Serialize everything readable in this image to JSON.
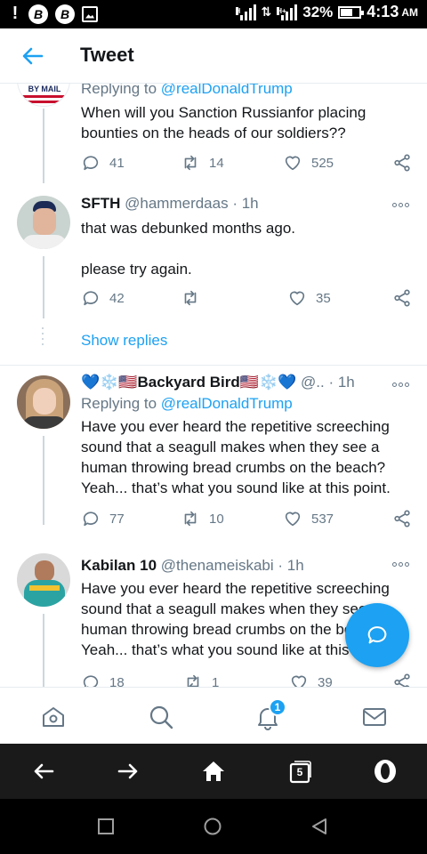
{
  "status_bar": {
    "battery": "32%",
    "time": "4:13",
    "ampm": "AM",
    "b_badge_1": "B",
    "b_badge_2": "B",
    "sig1_label": "H",
    "sig2_label": "H+"
  },
  "header": {
    "title": "Tweet"
  },
  "tweets": [
    {
      "avatar_text": "BY MAIL",
      "replying_label": "Replying to",
      "replying_handle": "@realDonaldTrump",
      "lines": [
        "When will you Sanction Russianfor placing",
        "bounties on the heads of our soldiers??"
      ],
      "replies": "41",
      "retweets": "14",
      "likes": "525"
    },
    {
      "name": "SFTH",
      "handle": "@hammerdaas",
      "time": "· 1h",
      "lines": [
        "that was debunked months ago.",
        "",
        "please try again."
      ],
      "replies": "42",
      "retweets": "",
      "likes": "35"
    },
    {
      "name": "💙❄️🇺🇸Backyard Bird🇺🇸❄️💙",
      "handle": "@..",
      "time": "· 1h",
      "replying_label": "Replying to",
      "replying_handle": "@realDonaldTrump",
      "lines": [
        "Have you ever heard the repetitive screeching",
        "sound that a seagull makes when they see a",
        "human throwing bread crumbs on the beach?",
        "Yeah... that’s what you sound like at this point."
      ],
      "replies": "77",
      "retweets": "10",
      "likes": "537"
    },
    {
      "name": "Kabilan 10",
      "handle": "@thenameiskabi",
      "time": "· 1h",
      "lines": [
        "Have you ever heard the repetitive screeching",
        "sound that a seagull makes when they see a",
        "human throwing bread crumbs on the beach?",
        "Yeah... that’s what you sound like at this point."
      ],
      "replies": "18",
      "retweets": "1",
      "likes": "39"
    }
  ],
  "show_replies": "Show replies",
  "tabbar": {
    "notification_count": "1"
  },
  "browser": {
    "tab_count": "5"
  },
  "colors": {
    "accent": "#1da1f2",
    "muted": "#657786",
    "text": "#14171a"
  }
}
